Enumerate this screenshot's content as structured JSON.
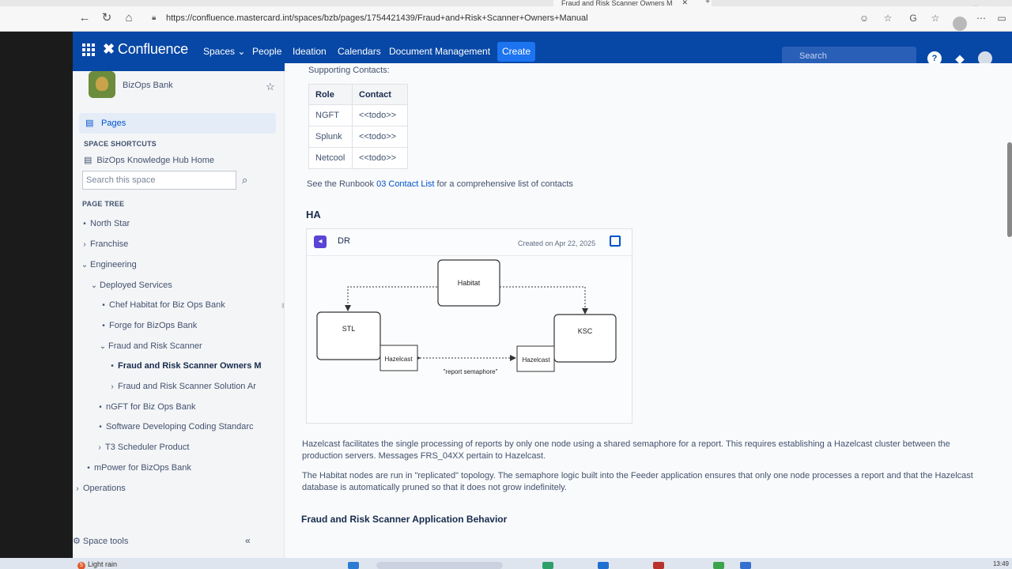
{
  "browser": {
    "tab_title": "Fraud and Risk Scanner Owners M",
    "url": "https://confluence.mastercard.int/spaces/bzb/pages/1754421439/Fraud+and+Risk+Scanner+Owners+Manual",
    "back_icon": "back-arrow-icon",
    "refresh_icon": "refresh-icon",
    "home_icon": "home-icon"
  },
  "header": {
    "logo": "Confluence",
    "nav": [
      "Spaces",
      "People",
      "Ideation",
      "Calendars",
      "Document Management"
    ],
    "create": "Create",
    "search_placeholder": "Search",
    "help": "?"
  },
  "sidebar": {
    "space_name": "BizOps Bank",
    "pages": "Pages",
    "shortcuts_title": "SPACE SHORTCUTS",
    "shortcut": "BizOps Knowledge Hub Home",
    "search_placeholder": "Search this space",
    "page_tree_title": "PAGE TREE",
    "tree": [
      {
        "label": "North Star",
        "marker": "•"
      },
      {
        "label": "Franchise",
        "marker": "›"
      },
      {
        "label": "Engineering",
        "marker": "⌄"
      },
      {
        "label": "Deployed Services",
        "marker": "⌄"
      },
      {
        "label": "Chef Habitat for Biz Ops Bank",
        "marker": "•"
      },
      {
        "label": "Forge for BizOps Bank",
        "marker": "•"
      },
      {
        "label": "Fraud and Risk Scanner",
        "marker": "⌄"
      },
      {
        "label": "Fraud and Risk Scanner Owners M",
        "marker": "•"
      },
      {
        "label": "Fraud and Risk Scanner Solution Ar",
        "marker": "›"
      },
      {
        "label": "nGFT for Biz Ops Bank",
        "marker": "•"
      },
      {
        "label": "Software Developing Coding Standarc",
        "marker": "•"
      },
      {
        "label": "T3 Scheduler Product",
        "marker": "›"
      },
      {
        "label": "mPower for BizOps Bank",
        "marker": "•"
      },
      {
        "label": "Operations",
        "marker": "›"
      }
    ],
    "space_tools": "Space tools",
    "collapse": "«"
  },
  "content": {
    "supporting_contacts": "Supporting Contacts:",
    "table": {
      "headers": [
        "Role",
        "Contact"
      ],
      "rows": [
        [
          "NGFT",
          "<<todo>>"
        ],
        [
          "Splunk",
          "<<todo>>"
        ],
        [
          "Netcool",
          "<<todo>>"
        ]
      ]
    },
    "see_runbook_pre": "See the Runbook ",
    "see_runbook_link": "03 Contact List",
    "see_runbook_post": " for a comprehensive list of contacts",
    "ha_heading": "HA",
    "diagram": {
      "title": "DR",
      "created": "Created on Apr 22, 2025",
      "nodes": {
        "habitat": "Habitat",
        "stl": "STL",
        "ksc": "KSC",
        "hazel_left": "Hazelcast",
        "hazel_right": "Hazelcast"
      },
      "edge_label": "\"report semaphore\""
    },
    "para1": "Hazelcast facilitates the single processing of reports by only one node using a shared semaphore for a report. This requires establishing a Hazelcast cluster between the production servers. Messages FRS_04XX pertain to Hazelcast.",
    "para2": "The Habitat nodes are run in \"replicated\" topology. The semaphore logic built into the Feeder application ensures that only one node processes a report and that the Hazelcast database is automatically pruned so that it does not grow indefinitely.",
    "behavior_heading": "Fraud and Risk Scanner Application Behavior"
  },
  "taskbar": {
    "weather_badge": "5",
    "weather": "Light rain",
    "clock": "13:49"
  },
  "colors": {
    "header_bg": "#0747a6",
    "create_btn": "#1c74f0",
    "link": "#0052cc"
  }
}
